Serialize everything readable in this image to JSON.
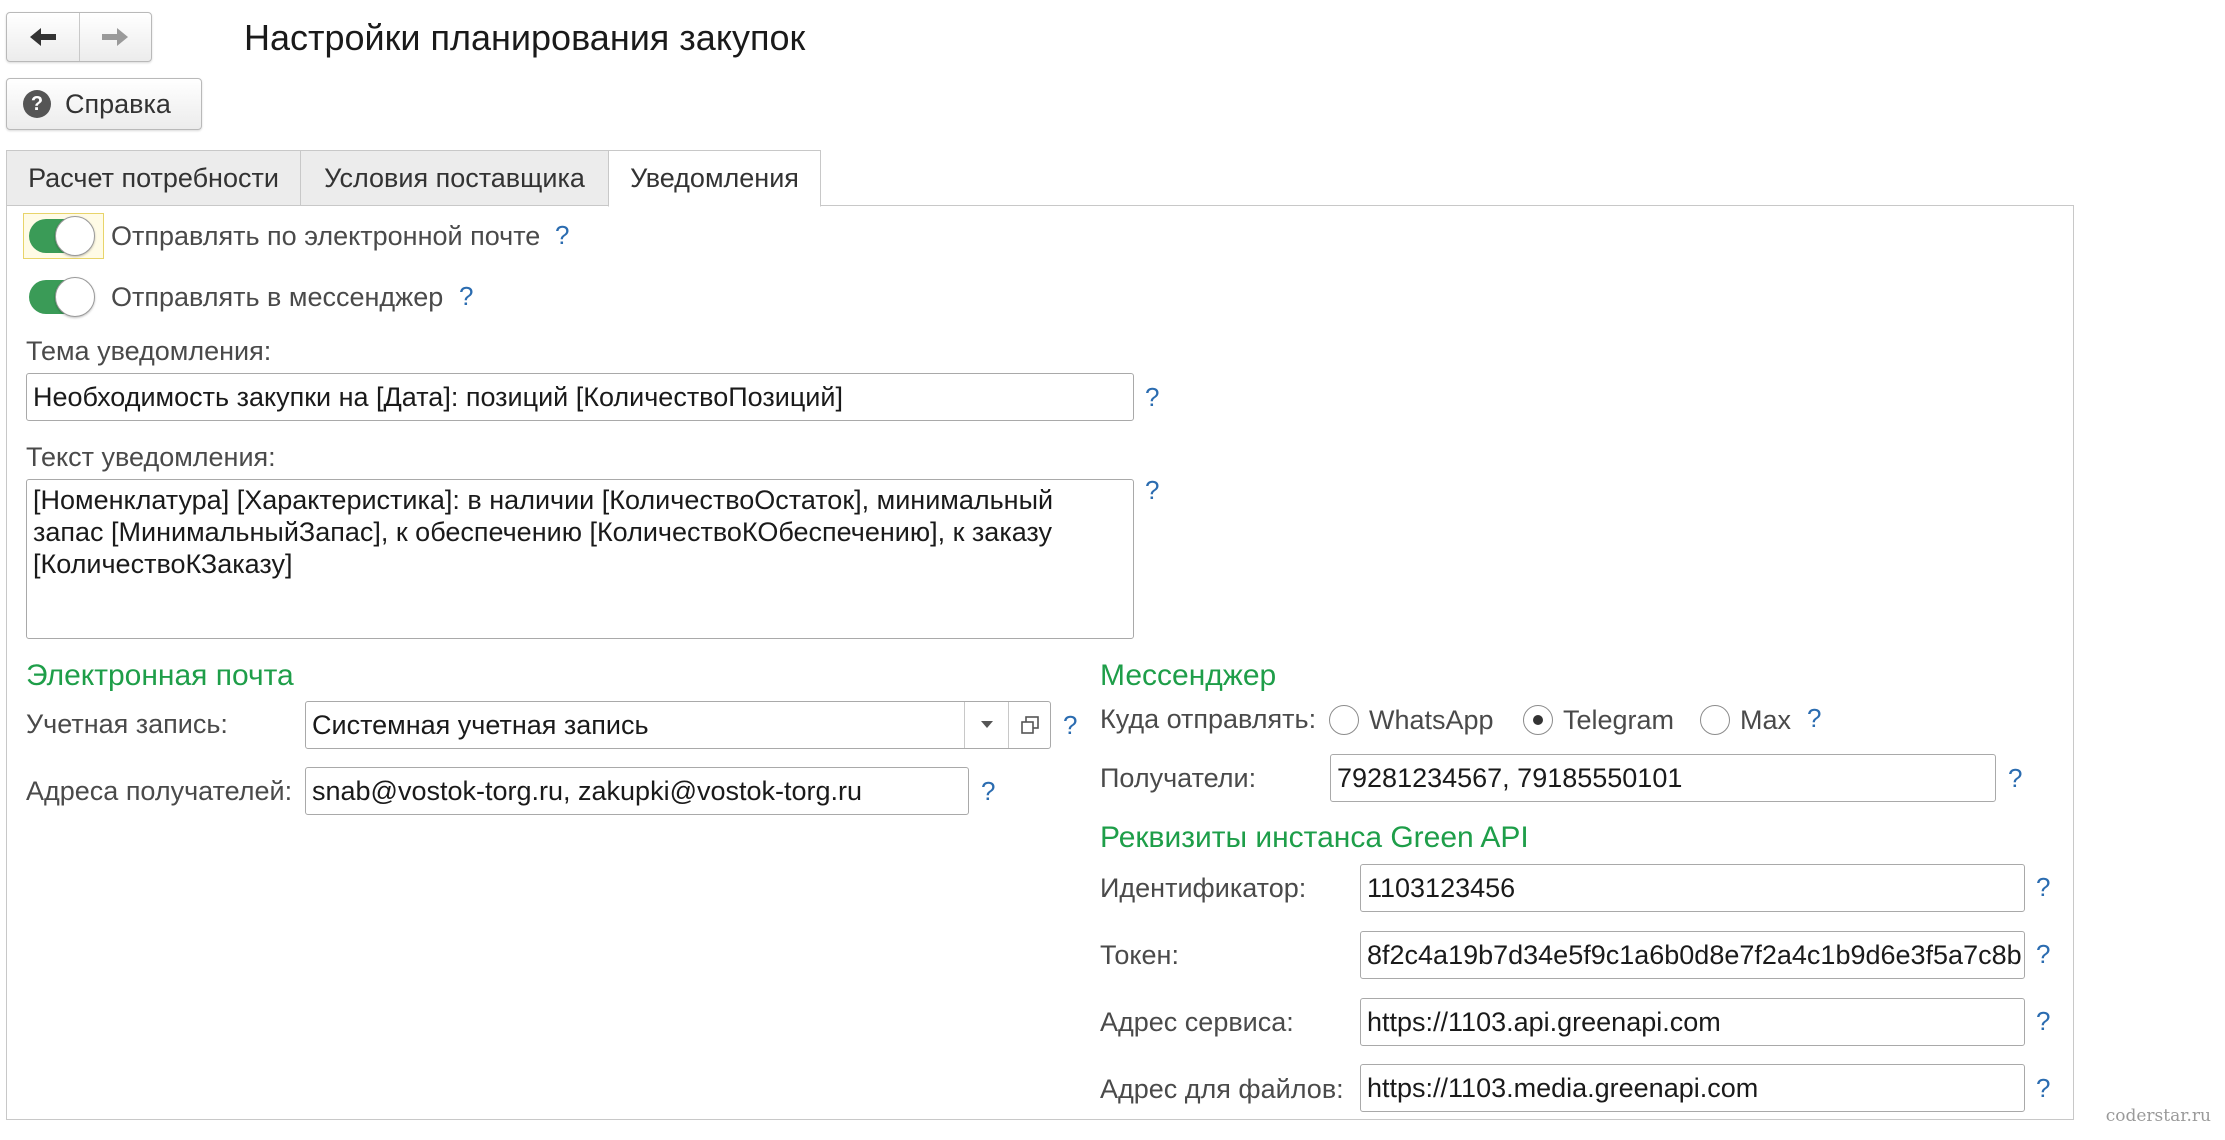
{
  "window": {
    "title": "Настройки планирования закупок"
  },
  "toolbar": {
    "help_label": "Справка"
  },
  "tabs": [
    {
      "label": "Расчет потребности"
    },
    {
      "label": "Условия поставщика"
    },
    {
      "label": "Уведомления"
    }
  ],
  "active_tab": "Уведомления",
  "toggles": {
    "email": {
      "label": "Отправлять по электронной почте",
      "on": true
    },
    "messenger": {
      "label": "Отправлять в мессенджер",
      "on": true
    }
  },
  "help_mark": "?",
  "subject": {
    "label": "Тема уведомления:",
    "value": "Необходимость закупки на [Дата]: позиций [КоличествоПозиций]"
  },
  "body": {
    "label": "Текст уведомления:",
    "value": "[Номенклатура] [Характеристика]: в наличии [КоличествоОстаток], минимальный запас [МинимальныйЗапас], к обеспечению [КоличествоКОбеспечению], к заказу [КоличествоКЗаказу]"
  },
  "email_section": {
    "title": "Электронная почта",
    "account_label": "Учетная запись:",
    "account_value": "Системная учетная запись",
    "recipients_label": "Адреса получателей:",
    "recipients_value": "snab@vostok-torg.ru, zakupki@vostok-torg.ru"
  },
  "messenger_section": {
    "title": "Мессенджер",
    "send_to_label": "Куда отправлять:",
    "options": [
      "WhatsApp",
      "Telegram",
      "Max"
    ],
    "selected": "Telegram",
    "recipients_label": "Получатели:",
    "recipients_value": "79281234567, 79185550101"
  },
  "green_api": {
    "title": "Реквизиты инстанса Green API",
    "id_label": "Идентификатор:",
    "id_value": "1103123456",
    "token_label": "Токен:",
    "token_value": "8f2c4a19b7d34e5f9c1a6b0d8e7f2a4c1b9d6e3f5a7c8b",
    "service_label": "Адрес сервиса:",
    "service_value": "https://1103.api.greenapi.com",
    "files_label": "Адрес для файлов:",
    "files_value": "https://1103.media.greenapi.com"
  },
  "watermark": "coderstar.ru",
  "colors": {
    "accent_green": "#1e9e49",
    "toggle_green": "#3a9b57",
    "help_blue": "#2b6cb0"
  }
}
